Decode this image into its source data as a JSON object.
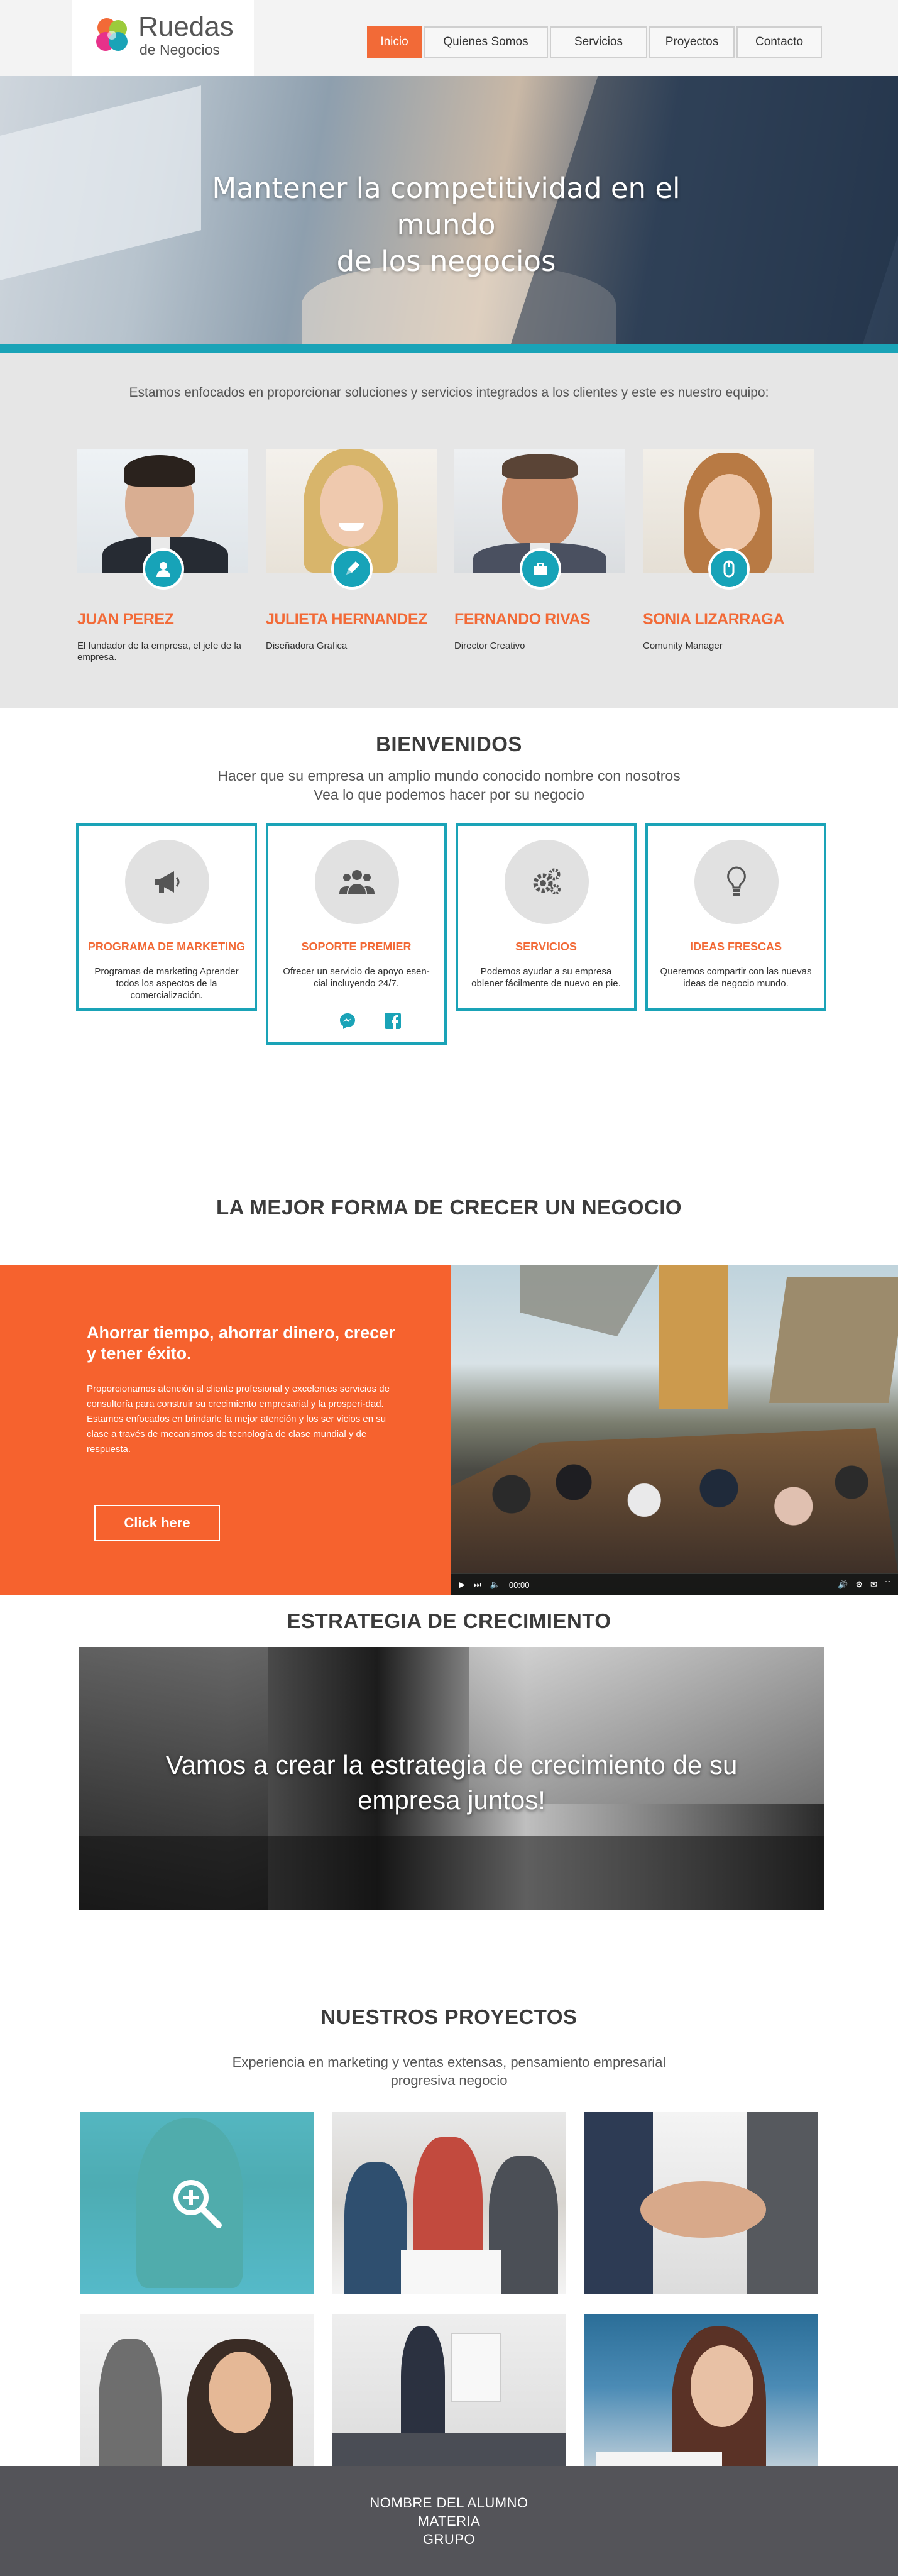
{
  "brand": {
    "name": "Ruedas",
    "tagline": "de Negocios",
    "colors": {
      "accent": "#f26a37",
      "teal": "#1aa3b7",
      "footer": "#545459"
    }
  },
  "nav": {
    "items": [
      {
        "label": "Inicio",
        "active": true
      },
      {
        "label": "Quienes Somos",
        "active": false
      },
      {
        "label": "Servicios",
        "active": false
      },
      {
        "label": "Proyectos",
        "active": false
      },
      {
        "label": "Contacto",
        "active": false
      }
    ]
  },
  "hero": {
    "title_line1": "Mantener la competitividad en el mundo",
    "title_line2": "de los negocios"
  },
  "team": {
    "intro": "Estamos enfocados en proporcionar soluciones y servicios integrados a los clientes y este es nuestro equipo:",
    "members": [
      {
        "name": "JUAN PEREZ",
        "role": "El fundador de la empresa, el jefe de la empresa.",
        "icon": "user-icon"
      },
      {
        "name": "JULIETA HERNANDEZ",
        "role": "Diseñadora Grafica",
        "icon": "pencil-icon"
      },
      {
        "name": "FERNANDO RIVAS",
        "role": "Director Creativo",
        "icon": "briefcase-icon"
      },
      {
        "name": "SONIA LIZARRAGA",
        "role": "Comunity Manager",
        "icon": "mouse-icon"
      }
    ]
  },
  "welcome": {
    "title": "BIENVENIDOS",
    "sub_line1": "Hacer que su empresa un amplio mundo conocido nombre con nosotros",
    "sub_line2": "Vea lo que podemos hacer por su negocio",
    "services": [
      {
        "title": "PROGRAMA DE MARKETING",
        "text": "Programas de marketing Aprender todos los aspectos de la comercialización.",
        "icon": "megaphone-icon"
      },
      {
        "title": "SOPORTE PREMIER",
        "text": "Ofrecer un servicio de apoyo esen-cial incluyendo 24/7.",
        "icon": "group-icon"
      },
      {
        "title": "SERVICIOS",
        "text": "Podemos ayudar a su empresa oblener fácilmente de nuevo en pie.",
        "icon": "gears-icon"
      },
      {
        "title": "IDEAS FRESCAS",
        "text": "Queremos compartir con las nuevas ideas de negocio mundo.",
        "icon": "lightbulb-icon"
      }
    ]
  },
  "mejor": {
    "title": "LA MEJOR FORMA DE CRECER UN NEGOCIO"
  },
  "promo": {
    "heading": "Ahorrar tiempo, ahorrar dinero, crecer y tener éxito.",
    "body": "Proporcionamos atención al cliente profesional y excelentes servicios de consultoría para construir su crecimiento empresarial y la prosperi-dad. Estamos enfocados en brindarle la mejor atención y los ser vicios en su clase a través de mecanismos de tecnología de clase mundial y de respuesta.",
    "button": "Click here",
    "video_time": "00:00"
  },
  "estrategia": {
    "title": "ESTRATEGIA DE CRECIMIENTO",
    "line1": "Vamos a crear la estrategia de crecimiento de su",
    "line2": "empresa juntos!"
  },
  "proyectos": {
    "title": "NUESTROS PROYECTOS",
    "sub_line1": "Experiencia en marketing y ventas extensas, pensamiento empresarial",
    "sub_line2": "progresiva negocio"
  },
  "footer": {
    "line1": "NOMBRE DEL ALUMNO",
    "line2": "MATERIA",
    "line3": "GRUPO"
  }
}
